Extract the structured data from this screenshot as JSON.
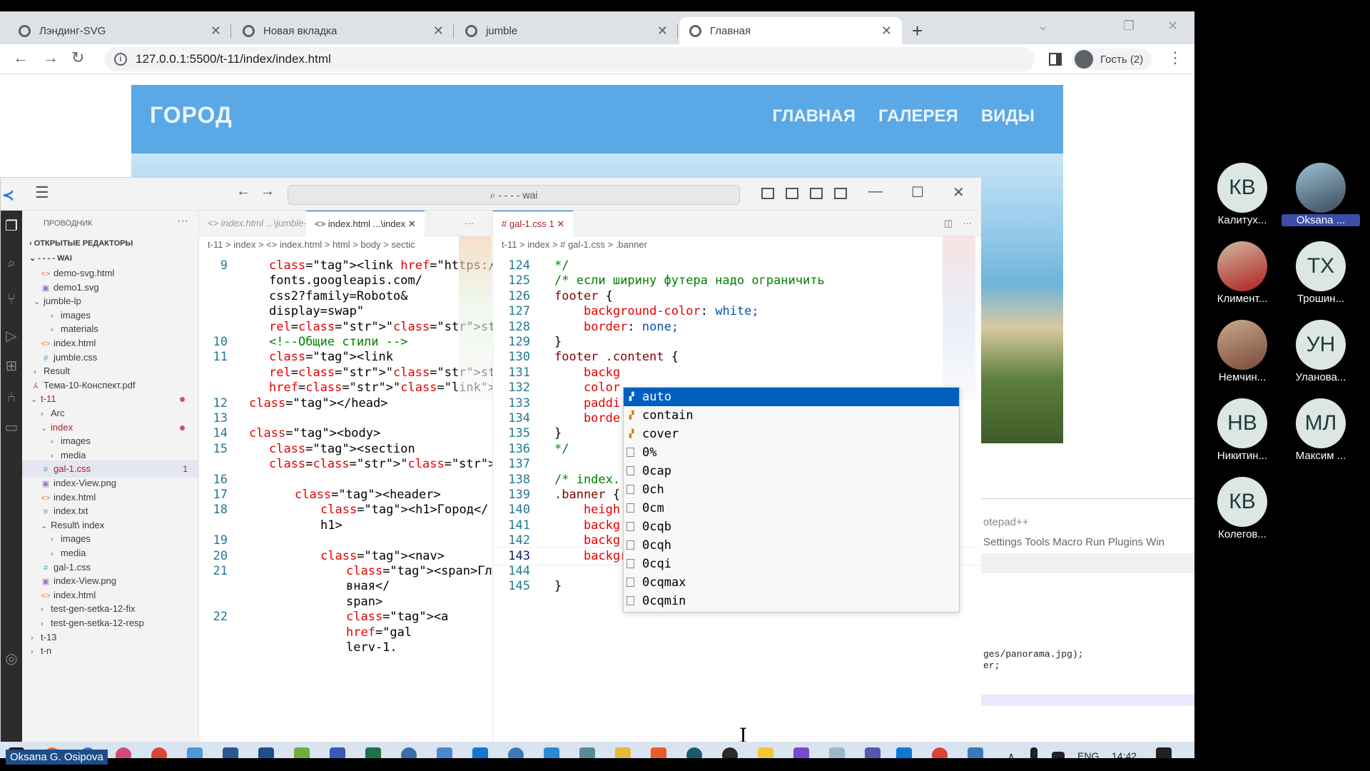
{
  "browser": {
    "tabs": [
      {
        "label": "Лэндинг-SVG"
      },
      {
        "label": "Новая вкладка"
      },
      {
        "label": "jumble"
      },
      {
        "label": "Главная"
      }
    ],
    "url": "127.0.0.1:5500/t-11/index/index.html",
    "profile": "Гость (2)"
  },
  "site": {
    "logo": "ГОРОД",
    "nav": [
      "ГЛАВНАЯ",
      "ГАЛЕРЕЯ",
      "ВИДЫ"
    ]
  },
  "notepad": {
    "title": "otepad++",
    "menu": "Settings   Tools   Macro   Run   Plugins   Win",
    "code_1": "ges/panorama.jpg);",
    "code_2": "er;"
  },
  "vscode": {
    "search": "- - - - wai",
    "explorer": {
      "heading": "ПРОВОДНИК",
      "open_editors": "ОТКРЫТЫЕ РЕДАКТОРЫ",
      "workspace": "- - - - WAI",
      "items": [
        {
          "label": "demo-svg.html"
        },
        {
          "label": "demo1.svg"
        },
        {
          "label": "jumble-lp"
        },
        {
          "label": "images"
        },
        {
          "label": "materials"
        },
        {
          "label": "index.html"
        },
        {
          "label": "jumble.css"
        },
        {
          "label": "Result"
        },
        {
          "label": "Тема-10-Конспект.pdf"
        },
        {
          "label": "t-11"
        },
        {
          "label": "Arc"
        },
        {
          "label": "index"
        },
        {
          "label": "images"
        },
        {
          "label": "media"
        },
        {
          "label": "gal-1.css",
          "badge": "1"
        },
        {
          "label": "index-View.png"
        },
        {
          "label": "index.html"
        },
        {
          "label": "index.txt"
        },
        {
          "label": "Result\\ index"
        },
        {
          "label": "images"
        },
        {
          "label": "media"
        },
        {
          "label": "gal-1.css"
        },
        {
          "label": "index-View.png"
        },
        {
          "label": "index.html"
        },
        {
          "label": "test-gen-setka-12-fix"
        },
        {
          "label": "test-gen-setka-12-resp"
        },
        {
          "label": "t-13"
        },
        {
          "label": "t-n"
        }
      ]
    },
    "left_editor": {
      "tabs": [
        "index.html ...\\jumble-lp",
        "index.html ...\\index"
      ],
      "breadcrumb": "t-11  >  index  >  <> index.html  >  html  >  body  >  sectic",
      "lines": [
        {
          "n": "9",
          "t": "<link href=\"https://"
        },
        {
          "n": "",
          "t": "fonts.googleapis.com/"
        },
        {
          "n": "",
          "t": "css2?family=Roboto&"
        },
        {
          "n": "",
          "t": "display=swap\""
        },
        {
          "n": "",
          "t": "rel=\"stylesheet\">"
        },
        {
          "n": "10",
          "t": "<!--Общие стили -->"
        },
        {
          "n": "11",
          "t": "<link"
        },
        {
          "n": "",
          "t": "rel=\"stylesheet\""
        },
        {
          "n": "",
          "t": "href=\"gal-1.css\">"
        },
        {
          "n": "12",
          "t": "</head>"
        },
        {
          "n": "13",
          "t": ""
        },
        {
          "n": "14",
          "t": "<body>"
        },
        {
          "n": "15",
          "t": "<section"
        },
        {
          "n": "",
          "t": "class=\"content\">"
        },
        {
          "n": "16",
          "t": ""
        },
        {
          "n": "17",
          "t": "<header>"
        },
        {
          "n": "18",
          "t": "<h1>Город</"
        },
        {
          "n": "",
          "t": "h1>"
        },
        {
          "n": "19",
          "t": ""
        },
        {
          "n": "20",
          "t": "<nav>"
        },
        {
          "n": "21",
          "t": "<span>Гла"
        },
        {
          "n": "",
          "t": "вная</"
        },
        {
          "n": "",
          "t": "span>"
        },
        {
          "n": "22",
          "t": "<a"
        },
        {
          "n": "",
          "t": "href=\"gal"
        },
        {
          "n": "",
          "t": "lerv-1."
        }
      ]
    },
    "right_editor": {
      "tab": "gal-1.css 1",
      "breadcrumb": "t-11  >  index  >  #  gal-1.css  >  .banner",
      "lines": [
        {
          "n": "124",
          "t": "*/"
        },
        {
          "n": "125",
          "t": "/* если ширину футера надо ограничить"
        },
        {
          "n": "126",
          "t": "footer {"
        },
        {
          "n": "127",
          "t": "    background-color: white;"
        },
        {
          "n": "128",
          "t": "    border: none;"
        },
        {
          "n": "129",
          "t": "}"
        },
        {
          "n": "130",
          "t": "footer .content {"
        },
        {
          "n": "131",
          "t": "    backg"
        },
        {
          "n": "132",
          "t": "    color"
        },
        {
          "n": "133",
          "t": "    paddi"
        },
        {
          "n": "134",
          "t": "    borde"
        },
        {
          "n": "135",
          "t": "}"
        },
        {
          "n": "136",
          "t": "*/"
        },
        {
          "n": "137",
          "t": ""
        },
        {
          "n": "138",
          "t": "/* index."
        },
        {
          "n": "139",
          "t": ".banner {"
        },
        {
          "n": "140",
          "t": "    heigh"
        },
        {
          "n": "141",
          "t": "    backg"
        },
        {
          "n": "142",
          "t": "    backg"
        },
        {
          "n": "143",
          "t": "    background-size: ;"
        },
        {
          "n": "144",
          "t": ""
        },
        {
          "n": "145",
          "t": "}"
        }
      ]
    },
    "suggestions": [
      "auto",
      "contain",
      "cover",
      "0%",
      "0cap",
      "0ch",
      "0cm",
      "0cqb",
      "0cqh",
      "0cqi",
      "0cqmax",
      "0cqmin"
    ]
  },
  "taskbar": {
    "lang": "ENG",
    "time": "14:42"
  },
  "presenter": "Oksana G. Osipova",
  "participants": [
    {
      "initials": "КВ",
      "name": "Калитух..."
    },
    {
      "initials": "",
      "name": "Oksana ..."
    },
    {
      "initials": "",
      "name": "Климент..."
    },
    {
      "initials": "ТХ",
      "name": "Трошин..."
    },
    {
      "initials": "",
      "name": "Немчин..."
    },
    {
      "initials": "УН",
      "name": "Уланова..."
    },
    {
      "initials": "НВ",
      "name": "Никитин..."
    },
    {
      "initials": "МЛ",
      "name": "Максим ..."
    },
    {
      "initials": "КВ",
      "name": "Колегов..."
    }
  ]
}
